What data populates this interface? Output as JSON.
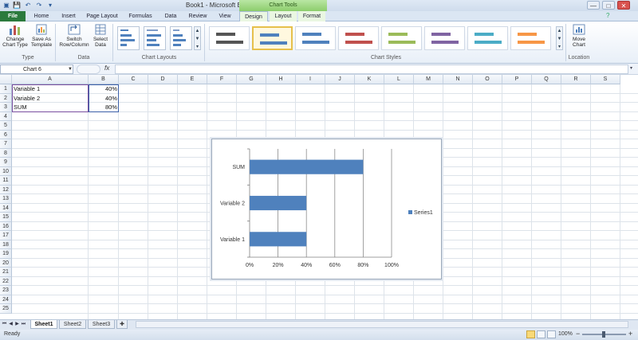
{
  "window": {
    "title": "Book1 - Microsoft Excel",
    "context_tools": "Chart Tools",
    "buttons": [
      "—",
      "□",
      "✕"
    ]
  },
  "ribbon_tabs": [
    {
      "label": "File"
    },
    {
      "label": "Home"
    },
    {
      "label": "Insert"
    },
    {
      "label": "Page Layout"
    },
    {
      "label": "Formulas"
    },
    {
      "label": "Data"
    },
    {
      "label": "Review"
    },
    {
      "label": "View"
    },
    {
      "label": "Design"
    },
    {
      "label": "Layout"
    },
    {
      "label": "Format"
    }
  ],
  "ribbon": {
    "groups": [
      {
        "label": "Type",
        "buttons": [
          {
            "label1": "Change",
            "label2": "Chart Type"
          },
          {
            "label1": "Save As",
            "label2": "Template"
          }
        ]
      },
      {
        "label": "Data",
        "buttons": [
          {
            "label1": "Switch",
            "label2": "Row/Column"
          },
          {
            "label1": "Select",
            "label2": "Data"
          }
        ]
      },
      {
        "label": "Chart Layouts"
      },
      {
        "label": "Chart Styles"
      },
      {
        "label": "Location",
        "buttons": [
          {
            "label1": "Move",
            "label2": "Chart"
          }
        ]
      }
    ],
    "style_colors": [
      "#555555",
      "#4f81bd",
      "#4f81bd",
      "#c0504d",
      "#9bbb59",
      "#8064a2",
      "#4bacc6",
      "#f79646"
    ]
  },
  "formula_bar": {
    "name_box": "Chart 6",
    "fx": "fx",
    "value": ""
  },
  "columns": [
    "A",
    "B",
    "C",
    "D",
    "E",
    "F",
    "G",
    "H",
    "I",
    "J",
    "K",
    "L",
    "M",
    "N",
    "O",
    "P",
    "Q",
    "R",
    "S"
  ],
  "rows": [
    "1",
    "2",
    "3",
    "4",
    "5",
    "6",
    "7",
    "8",
    "9",
    "10",
    "11",
    "12",
    "13",
    "14",
    "15",
    "16",
    "17",
    "18",
    "19",
    "20",
    "21",
    "22",
    "23",
    "24",
    "25"
  ],
  "cells": {
    "A1": "Variable 1",
    "B1": "40%",
    "A2": "Variable 2",
    "B2": "40%",
    "A3": "SUM",
    "B3": "80%"
  },
  "chart_data": {
    "type": "bar",
    "orientation": "horizontal",
    "categories": [
      "Variable 1",
      "Variable 2",
      "SUM"
    ],
    "series": [
      {
        "name": "Series1",
        "values": [
          0.4,
          0.4,
          0.8
        ],
        "color": "#4f81bd"
      }
    ],
    "x_ticks": [
      "0%",
      "20%",
      "40%",
      "60%",
      "80%",
      "100%"
    ],
    "xlim": [
      0,
      1
    ],
    "grid": true,
    "legend": "right"
  },
  "sheets": [
    {
      "label": "Sheet1"
    },
    {
      "label": "Sheet2"
    },
    {
      "label": "Sheet3"
    }
  ],
  "status": {
    "text": "Ready",
    "zoom": "100%"
  }
}
